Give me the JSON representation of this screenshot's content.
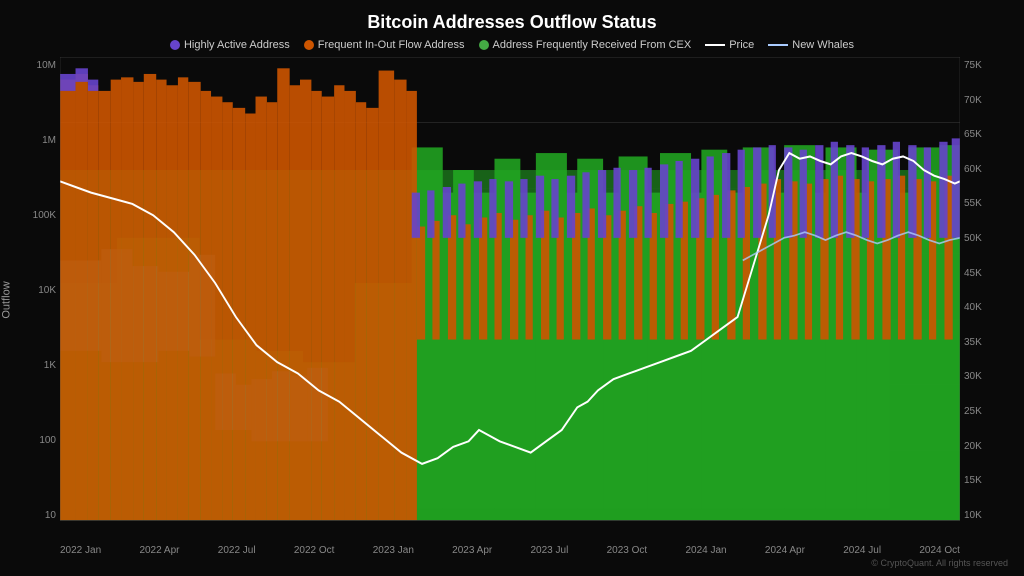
{
  "title": "Bitcoin Addresses Outflow Status",
  "legend": [
    {
      "label": "Highly Active Address",
      "type": "dot",
      "color": "#6644cc"
    },
    {
      "label": "Frequent In-Out Flow Address",
      "type": "dot",
      "color": "#cc5500"
    },
    {
      "label": "Address Frequently Received From CEX",
      "type": "dot",
      "color": "#44aa44"
    },
    {
      "label": "Price",
      "type": "line",
      "color": "#ffffff"
    },
    {
      "label": "New Whales",
      "type": "line",
      "color": "#aaccff"
    }
  ],
  "yAxisLeft": {
    "label": "Outflow",
    "ticks": [
      "10M",
      "1M",
      "100K",
      "10K",
      "1K",
      "100",
      "10"
    ]
  },
  "yAxisRight": {
    "ticks": [
      "75K",
      "70K",
      "65K",
      "60K",
      "55K",
      "50K",
      "45K",
      "40K",
      "35K",
      "30K",
      "25K",
      "20K",
      "15K",
      "10K"
    ]
  },
  "xAxisTicks": [
    "2022 Jan",
    "2022 Apr",
    "2022 Jul",
    "2022 Oct",
    "2023 Jan",
    "2023 Apr",
    "2023 Jul",
    "2023 Oct",
    "2024 Jan",
    "2024 Apr",
    "2024 Jul",
    "2024 Oct"
  ],
  "copyright": "© CryptoQuant. All rights reserved"
}
